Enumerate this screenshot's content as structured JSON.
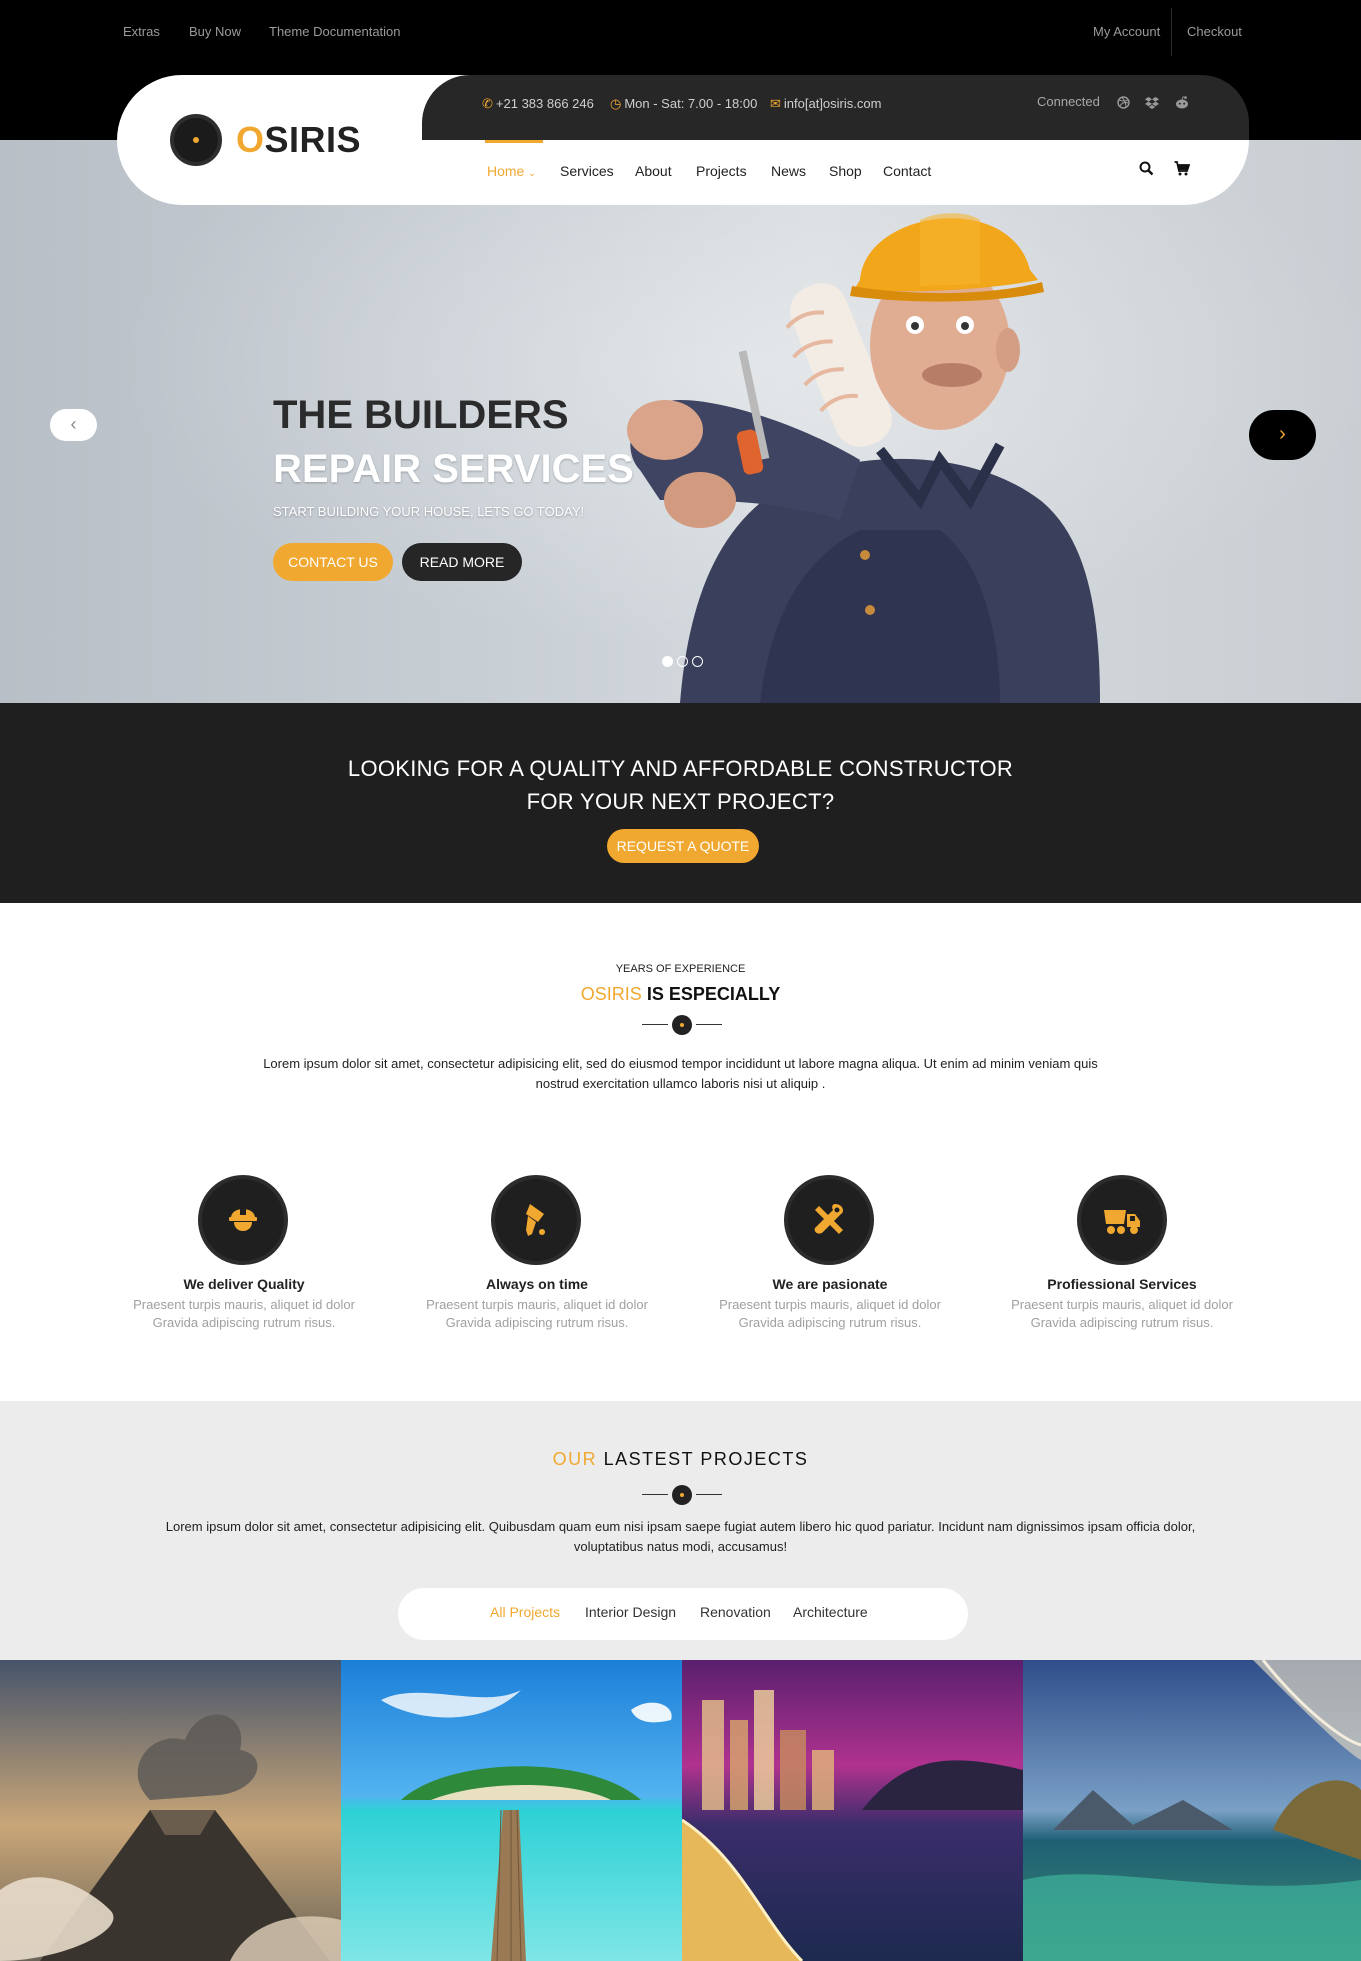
{
  "topbar": {
    "left_links": [
      "Extras",
      "Buy Now",
      "Theme Documentation"
    ],
    "right_links": [
      "My Account",
      "Checkout"
    ]
  },
  "header": {
    "logo": {
      "first_letter": "O",
      "rest": "SIRIS"
    },
    "contact": {
      "phone": "+21 383 866 246",
      "hours": "Mon - Sat: 7.00 - 18:00",
      "email": "info[at]osiris.com"
    },
    "social_label": "Connected",
    "social_icons": [
      "dribbble-icon",
      "dropbox-icon",
      "reddit-icon"
    ],
    "nav": [
      "Home",
      "Services",
      "About",
      "Projects",
      "News",
      "Shop",
      "Contact"
    ],
    "active_nav": "Home"
  },
  "hero": {
    "title_line1": "THE BUILDERS",
    "title_line2": "REPAIR SERVICES",
    "subtitle": "START BUILDING YOUR HOUSE, LETS GO TODAY!",
    "primary_button": "CONTACT US",
    "secondary_button": "READ MORE",
    "slide_count": 3,
    "active_slide": 1
  },
  "quote": {
    "line1": "LOOKING FOR A QUALITY AND AFFORDABLE CONSTRUCTOR",
    "line2": "FOR YOUR NEXT PROJECT?",
    "button": "REQUEST A QUOTE"
  },
  "experience": {
    "eyebrow": "YEARS OF EXPERIENCE",
    "title_highlight": "OSIRIS",
    "title_rest": "IS ESPECIALLY",
    "paragraph_line1": "Lorem ipsum dolor sit amet, consectetur adipisicing elit, sed do eiusmod tempor incididunt ut labore magna aliqua. Ut enim ad minim veniam quis",
    "paragraph_line2": "nostrud exercitation ullamco laboris nisi ut aliquip ."
  },
  "features": [
    {
      "icon": "hard-hat-worker-icon",
      "title": "We deliver Quality",
      "desc1": "Praesent turpis mauris, aliquet id dolor",
      "desc2": "Gravida adipiscing rutrum risus."
    },
    {
      "icon": "paint-brush-icon",
      "title": "Always on time",
      "desc1": "Praesent turpis mauris, aliquet id dolor",
      "desc2": "Gravida adipiscing rutrum risus."
    },
    {
      "icon": "tools-icon",
      "title": "We are pasionate",
      "desc1": "Praesent turpis mauris, aliquet id dolor",
      "desc2": "Gravida adipiscing rutrum risus."
    },
    {
      "icon": "dump-truck-icon",
      "title": "Profiessional Services",
      "desc1": "Praesent turpis mauris, aliquet id dolor",
      "desc2": "Gravida adipiscing rutrum risus."
    }
  ],
  "projects": {
    "title_highlight": "OUR",
    "title_rest": "LASTEST PROJECTS",
    "paragraph_line1": "Lorem ipsum dolor sit amet, consectetur adipisicing elit. Quibusdam quam eum nisi ipsam saepe fugiat autem libero hic quod pariatur. Incidunt nam dignissimos ipsam officia dolor,",
    "paragraph_line2": "voluptatibus natus modi, accusamus!",
    "filters": [
      "All Projects",
      "Interior Design",
      "Renovation",
      "Architecture"
    ],
    "active_filter": "All Projects",
    "tiles": [
      "volcano-image",
      "tropical-pier-image",
      "city-beach-night-image",
      "fantasy-planet-lake-image"
    ]
  },
  "colors": {
    "accent": "#f1a830",
    "dark": "#1f1f1f",
    "topbar": "#000000",
    "light_band": "#ececec"
  }
}
